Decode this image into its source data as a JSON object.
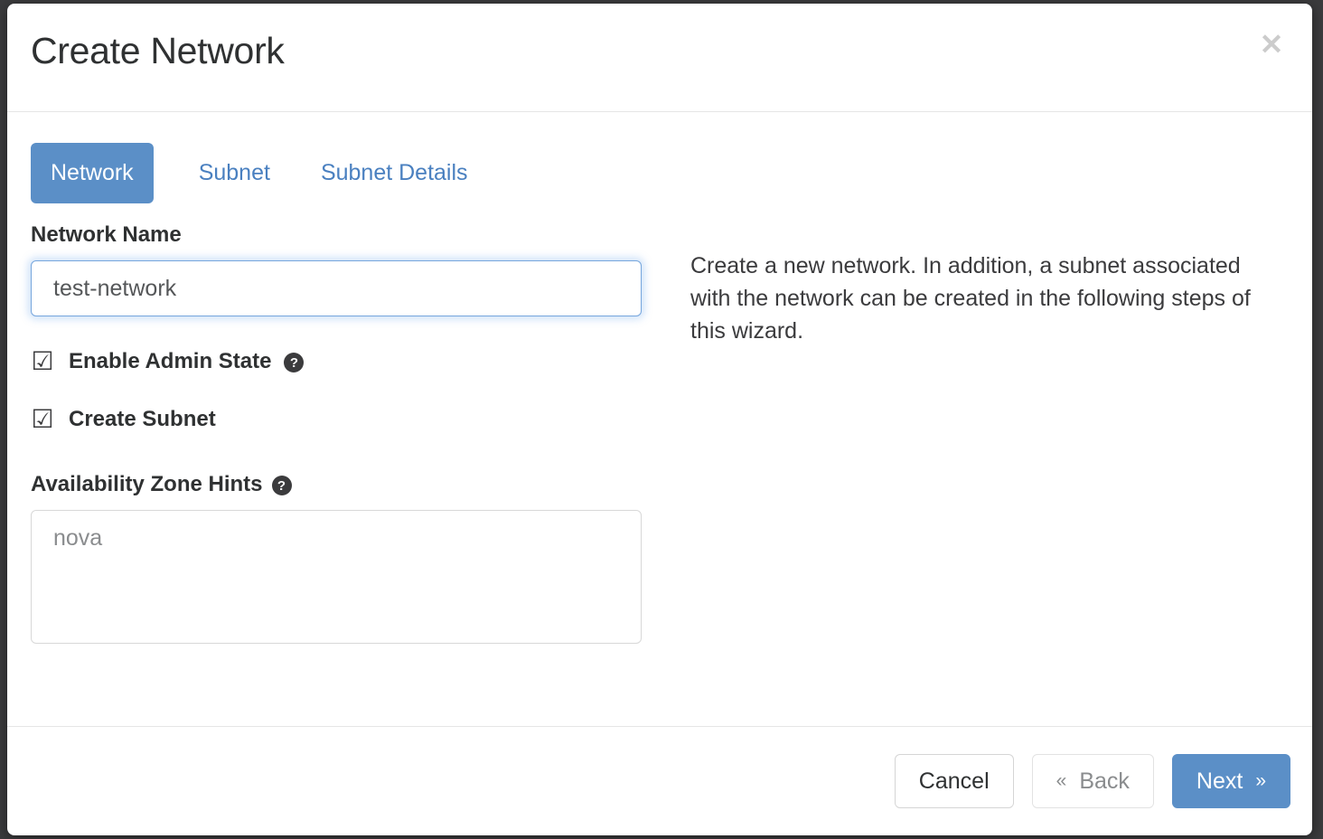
{
  "dialog": {
    "title": "Create Network",
    "close_icon": "close-icon",
    "close_glyph": "✕"
  },
  "tabs": [
    {
      "label": "Network",
      "active": true
    },
    {
      "label": "Subnet",
      "active": false
    },
    {
      "label": "Subnet Details",
      "active": false
    }
  ],
  "form": {
    "network_name": {
      "label": "Network Name",
      "value": "test-network",
      "placeholder": ""
    },
    "enable_admin_state": {
      "label": "Enable Admin State",
      "checked": true,
      "checkbox_glyph": "☑",
      "help_glyph": "?"
    },
    "create_subnet": {
      "label": "Create Subnet",
      "checked": true,
      "checkbox_glyph": "☑"
    },
    "availability_zone_hints": {
      "label": "Availability Zone Hints",
      "help_glyph": "?",
      "value": "nova"
    }
  },
  "help": {
    "text": "Create a new network. In addition, a subnet associated with the network can be created in the following steps of this wizard."
  },
  "footer": {
    "cancel_label": "Cancel",
    "back_label": "Back",
    "back_chevron": "«",
    "next_label": "Next",
    "next_chevron": "»"
  },
  "colors": {
    "accent": "#5b8fc7",
    "link": "#4a80c0",
    "text": "#2f3132",
    "muted": "#8a8c8e",
    "border": "#d8d8d8",
    "backdrop": "#3b3b3d"
  }
}
